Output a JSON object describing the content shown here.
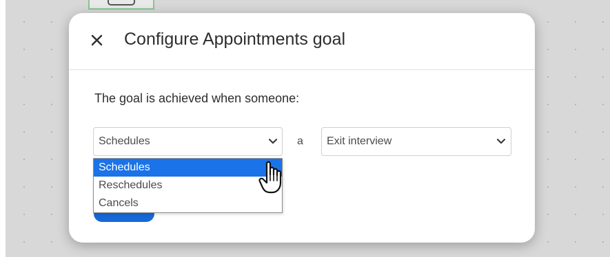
{
  "modal": {
    "title": "Configure Appointments goal",
    "prompt": "The goal is achieved when someone:",
    "article": "a"
  },
  "action_select": {
    "value": "Schedules",
    "options": [
      {
        "label": "Schedules",
        "selected": true
      },
      {
        "label": "Reschedules",
        "selected": false
      },
      {
        "label": "Cancels",
        "selected": false
      }
    ]
  },
  "appointment_select": {
    "value": "Exit interview"
  },
  "colors": {
    "selected_option": "#1a73e8",
    "primary_button": "#1769d6",
    "canvas": "#d8d8d8"
  },
  "icons": {
    "close": "close-icon",
    "dropdown": "chevron-down-icon",
    "cursor": "hand-pointer-icon"
  }
}
